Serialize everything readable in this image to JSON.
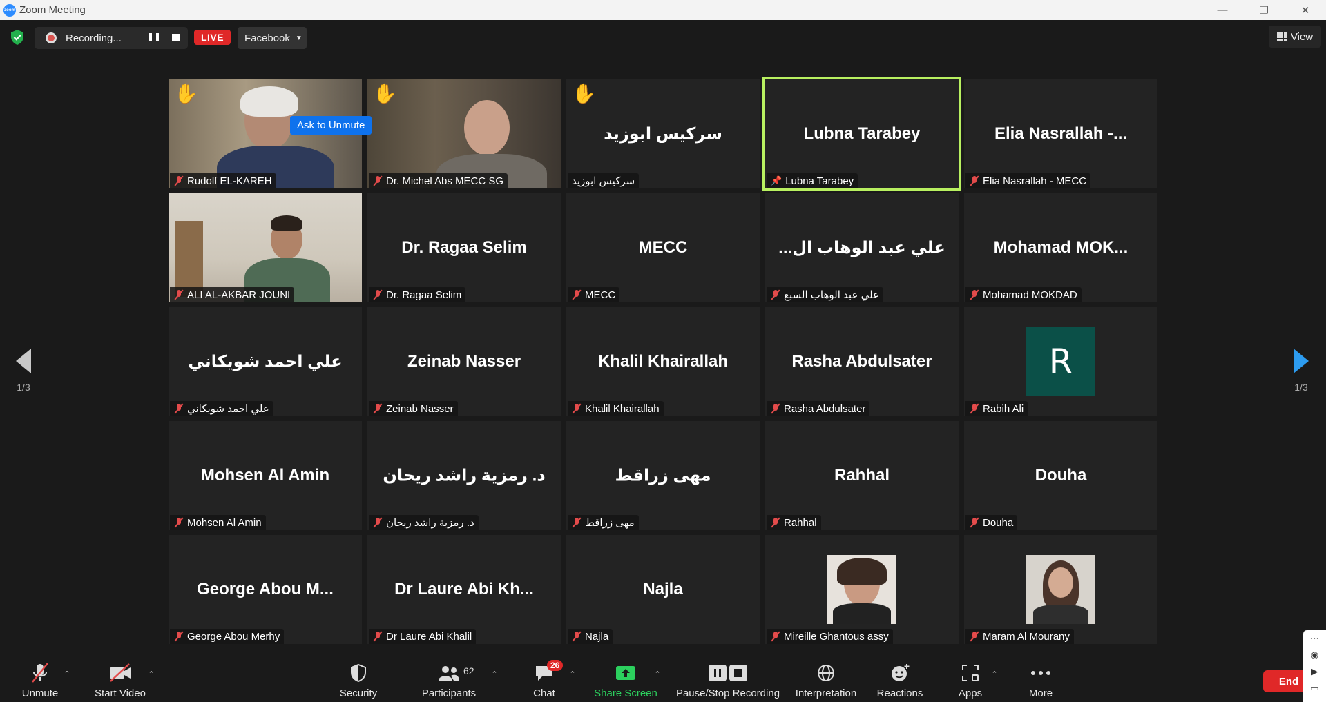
{
  "window": {
    "title": "Zoom Meeting",
    "logo_text": "zoom"
  },
  "topbar": {
    "recording_label": "Recording...",
    "live_label": "LIVE",
    "stream_target": "Facebook",
    "view_label": "View"
  },
  "ask_unmute": "Ask to Unmute",
  "tiles": [
    {
      "center": "",
      "label": "Rudolf EL-KAREH",
      "hand": true,
      "video": "a"
    },
    {
      "center": "",
      "label": "Dr. Michel Abs MECC SG",
      "hand": true,
      "video": "b"
    },
    {
      "center": "سركيس ابوزيد",
      "label": "سركيس ابوزيد",
      "hand": true,
      "mic": false
    },
    {
      "center": "Lubna Tarabey",
      "label": "Lubna Tarabey",
      "pinned": true,
      "active": true
    },
    {
      "center": "Elia  Nasrallah -...",
      "label": "Elia Nasrallah - MECC"
    },
    {
      "center": "",
      "label": "ALI AL-AKBAR JOUNI",
      "video": "c"
    },
    {
      "center": "Dr. Ragaa Selim",
      "label": "Dr. Ragaa Selim"
    },
    {
      "center": "MECC",
      "label": "MECC"
    },
    {
      "center": "...علي عبد الوهاب ال",
      "label": "علي عبد الوهاب السبع"
    },
    {
      "center": "Mohamad  MOK...",
      "label": "Mohamad MOKDAD"
    },
    {
      "center": "علي احمد شويكاني",
      "label": "علي احمد شويكاني"
    },
    {
      "center": "Zeinab Nasser",
      "label": "Zeinab Nasser"
    },
    {
      "center": "Khalil Khairallah",
      "label": "Khalil Khairallah"
    },
    {
      "center": "Rasha Abdulsater",
      "label": "Rasha Abdulsater"
    },
    {
      "center": "",
      "label": "Rabih Ali",
      "avatar": "R"
    },
    {
      "center": "Mohsen Al Amin",
      "label": "Mohsen Al Amin"
    },
    {
      "center": "د. رمزية راشد ريحان",
      "label": "د. رمزية راشد ريحان"
    },
    {
      "center": "مهى زراقط",
      "label": "مهى زراقط"
    },
    {
      "center": "Rahhal",
      "label": "Rahhal"
    },
    {
      "center": "Douha",
      "label": "Douha"
    },
    {
      "center": "George Abou M...",
      "label": "George Abou Merhy"
    },
    {
      "center": "Dr Laure Abi Kh...",
      "label": "Dr Laure Abi Khalil"
    },
    {
      "center": "Najla",
      "label": "Najla"
    },
    {
      "center": "",
      "label": "Mireille Ghantous assy",
      "photo": "f1"
    },
    {
      "center": "",
      "label": "Maram Al Mourany",
      "photo": "f2"
    }
  ],
  "pager": {
    "left": "1/3",
    "right": "1/3"
  },
  "toolbar": {
    "unmute": "Unmute",
    "start_video": "Start Video",
    "security": "Security",
    "participants": "Participants",
    "participants_count": "62",
    "chat": "Chat",
    "chat_badge": "26",
    "share_screen": "Share Screen",
    "pause_stop_recording": "Pause/Stop Recording",
    "interpretation": "Interpretation",
    "reactions": "Reactions",
    "apps": "Apps",
    "more": "More",
    "end": "End"
  },
  "colors": {
    "active_speaker": "#b8f060",
    "end": "#e02828",
    "share": "#2cd05e",
    "accent": "#0e72ed"
  }
}
